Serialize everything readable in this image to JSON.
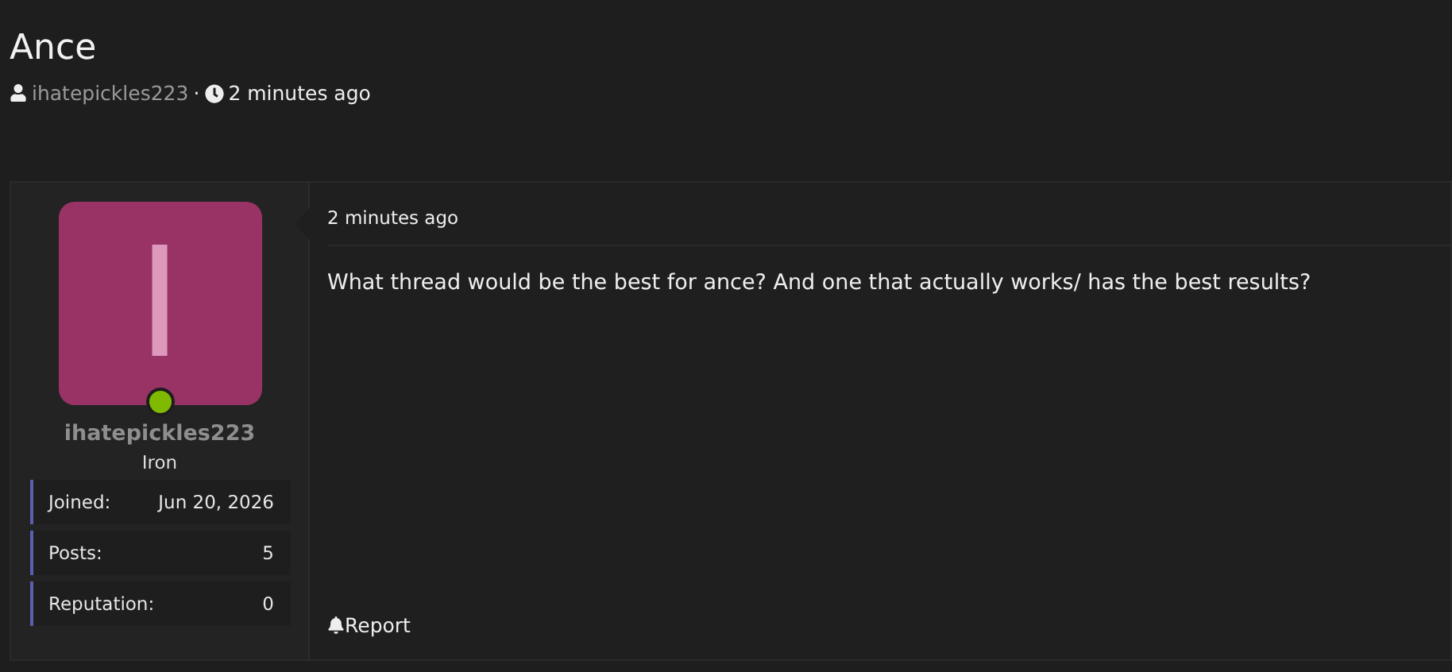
{
  "thread": {
    "title": "Ance",
    "author": "ihatepickles223",
    "separator": "·",
    "time": "2 minutes ago"
  },
  "post": {
    "user": {
      "avatar_letter": "I",
      "online": true,
      "name": "ihatepickles223",
      "rank": "Iron",
      "stats": [
        {
          "label": "Joined:",
          "value": "Jun 20, 2026"
        },
        {
          "label": "Posts:",
          "value": "5"
        },
        {
          "label": "Reputation:",
          "value": "0"
        }
      ]
    },
    "time": "2 minutes ago",
    "body": "What thread would be the best for ance? And one that actually works/ has the best results?",
    "report": "Report"
  }
}
